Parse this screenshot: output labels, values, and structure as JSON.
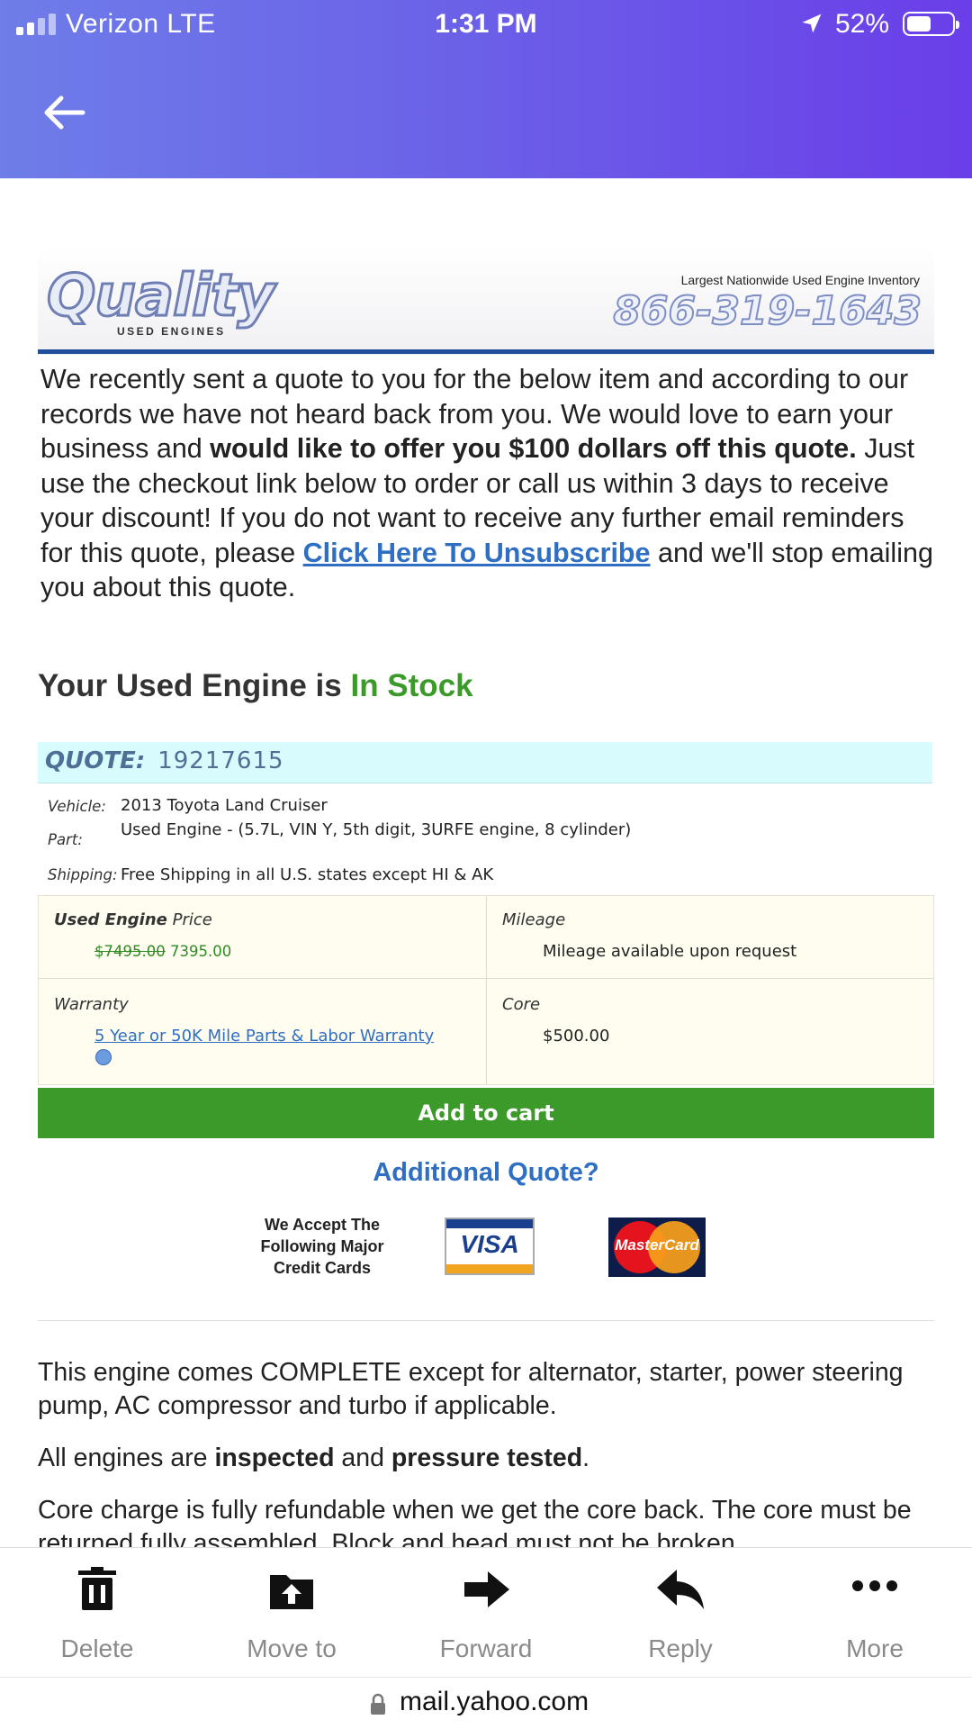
{
  "status_bar": {
    "carrier": "Verizon  LTE",
    "time": "1:31 PM",
    "battery": "52%"
  },
  "email": {
    "logo": {
      "main": "Quality",
      "sub": "USED ENGINES",
      "tagline": "Largest Nationwide Used Engine Inventory",
      "phone": "866-319-1643"
    },
    "intro": {
      "p1": "We recently sent a quote to you for the below item and according to our records we have not heard back from you. We would love to earn your business and ",
      "bold": "would like to offer you $100 dollars off this quote.",
      "p2": " Just use the checkout link below to order or call us within 3 days to receive your discount! If you do not want to receive any further email reminders for this quote, please ",
      "link": "Click Here To Unsubscribe",
      "p3": " and we'll stop emailing you about this quote."
    },
    "stock": {
      "prefix": "Your Used Engine is ",
      "status": "In Stock",
      "status_color": "#3b9a2a"
    },
    "quote": {
      "label": "QUOTE:",
      "number": "19217615"
    },
    "details": {
      "vehicle_label": "Vehicle:",
      "vehicle": "2013 Toyota Land Cruiser",
      "part_label": "Part:",
      "part": "Used Engine - (5.7L, VIN Y, 5th digit, 3URFE engine, 8 cylinder)",
      "shipping_label": "Shipping:",
      "shipping": "Free Shipping in all U.S. states except HI & AK"
    },
    "grid": {
      "price_label_bold": "Used Engine",
      "price_label": " Price",
      "price_old": "$7495.00",
      "price_new": "7395.00",
      "mileage_label": "Mileage",
      "mileage": "Mileage available upon request",
      "warranty_label": "Warranty",
      "warranty": "5 Year or 50K Mile Parts & Labor Warranty",
      "core_label": "Core",
      "core": "$500.00"
    },
    "add_to_cart": "Add to cart",
    "additional_quote": "Additional Quote?",
    "accept_text": "We Accept The Following Major Credit Cards",
    "visa": "VISA",
    "mastercard": "MasterCard",
    "complete": "This engine comes COMPLETE except for alternator, starter, power steering pump, AC compressor and turbo if applicable.",
    "inspected": {
      "a": "All engines are ",
      "b": "inspected",
      "c": " and ",
      "d": "pressure tested",
      "e": "."
    },
    "core_charge": "Core charge is fully refundable when we get the core back. The core must be returned fully assembled. Block and head must not be broken"
  },
  "toolbar": {
    "delete": "Delete",
    "move_to": "Move to",
    "forward": "Forward",
    "reply": "Reply",
    "more": "More"
  },
  "url": "mail.yahoo.com"
}
